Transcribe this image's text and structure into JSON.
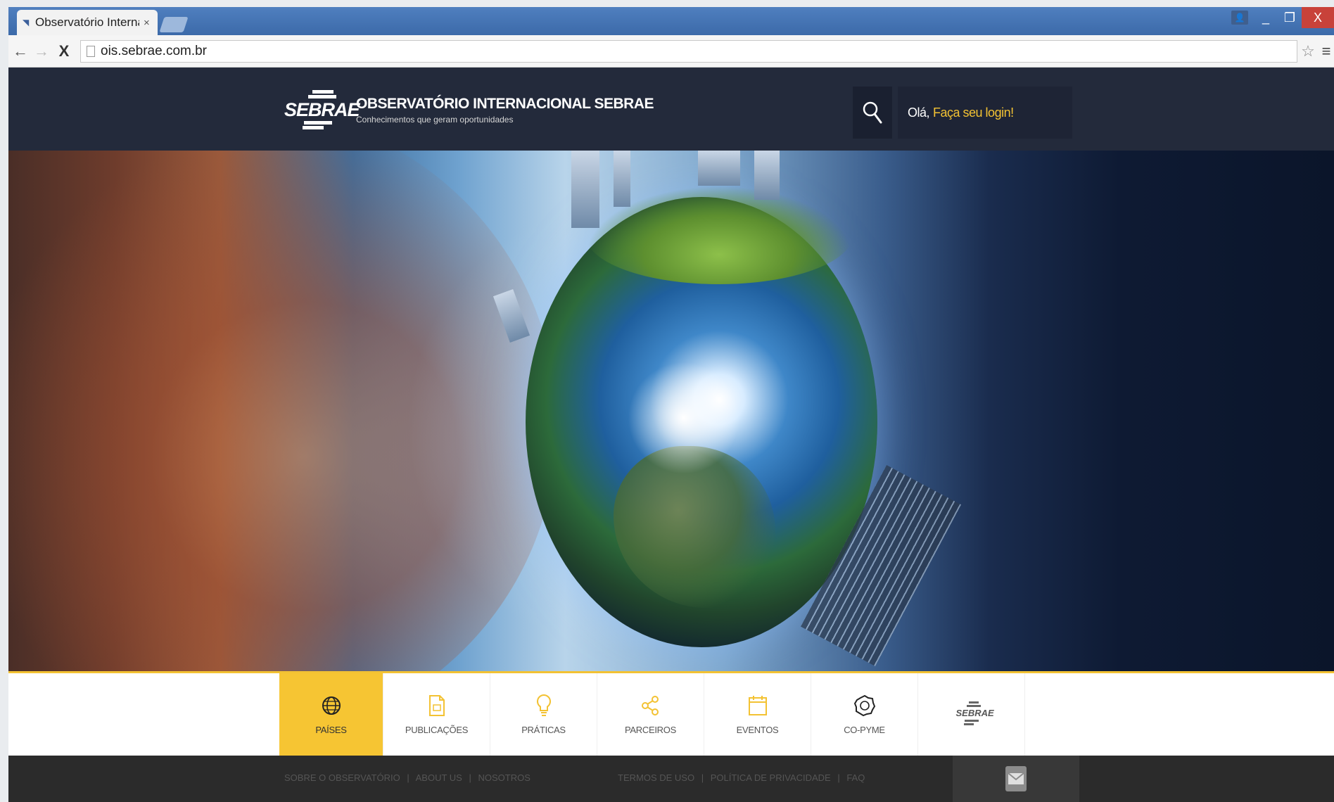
{
  "browser": {
    "tab_title": "Observatório Interna",
    "tab_close": "×",
    "url": "ois.sebrae.com.br",
    "back": "←",
    "forward": "→",
    "stop": "X",
    "star": "☆",
    "menu": "≡",
    "window_controls": {
      "minimize": "_",
      "restore": "❐",
      "close": "X"
    }
  },
  "header": {
    "logo_word": "SEBRAE",
    "site_name": "OBSERVATÓRIO INTERNACIONAL SEBRAE",
    "slogan": "Conhecimentos que geram oportunidades",
    "greeting": "Olá,",
    "login_link": "Faça seu login!"
  },
  "nav": {
    "items": [
      {
        "label": "PAÍSES",
        "icon": "globe-icon",
        "active": true
      },
      {
        "label": "PUBLICAÇÕES",
        "icon": "document-icon"
      },
      {
        "label": "PRÁTICAS",
        "icon": "lightbulb-icon"
      },
      {
        "label": "PARCEIROS",
        "icon": "network-icon"
      },
      {
        "label": "EVENTOS",
        "icon": "calendar-icon"
      },
      {
        "label": "CO-PYME",
        "icon": "gear-icon"
      }
    ],
    "sebrae_logo": "SEBRAE"
  },
  "footer": {
    "links_left": [
      "SOBRE O OBSERVATÓRIO",
      "ABOUT US",
      "NOSOTROS"
    ],
    "links_mid": [
      "TERMOS DE USO",
      "POLÍTICA DE PRIVACIDADE",
      "FAQ"
    ],
    "separator": "|"
  },
  "colors": {
    "accent": "#f3c233",
    "header_bg": "#232a3b",
    "footer_bg": "#2b2b2b"
  }
}
